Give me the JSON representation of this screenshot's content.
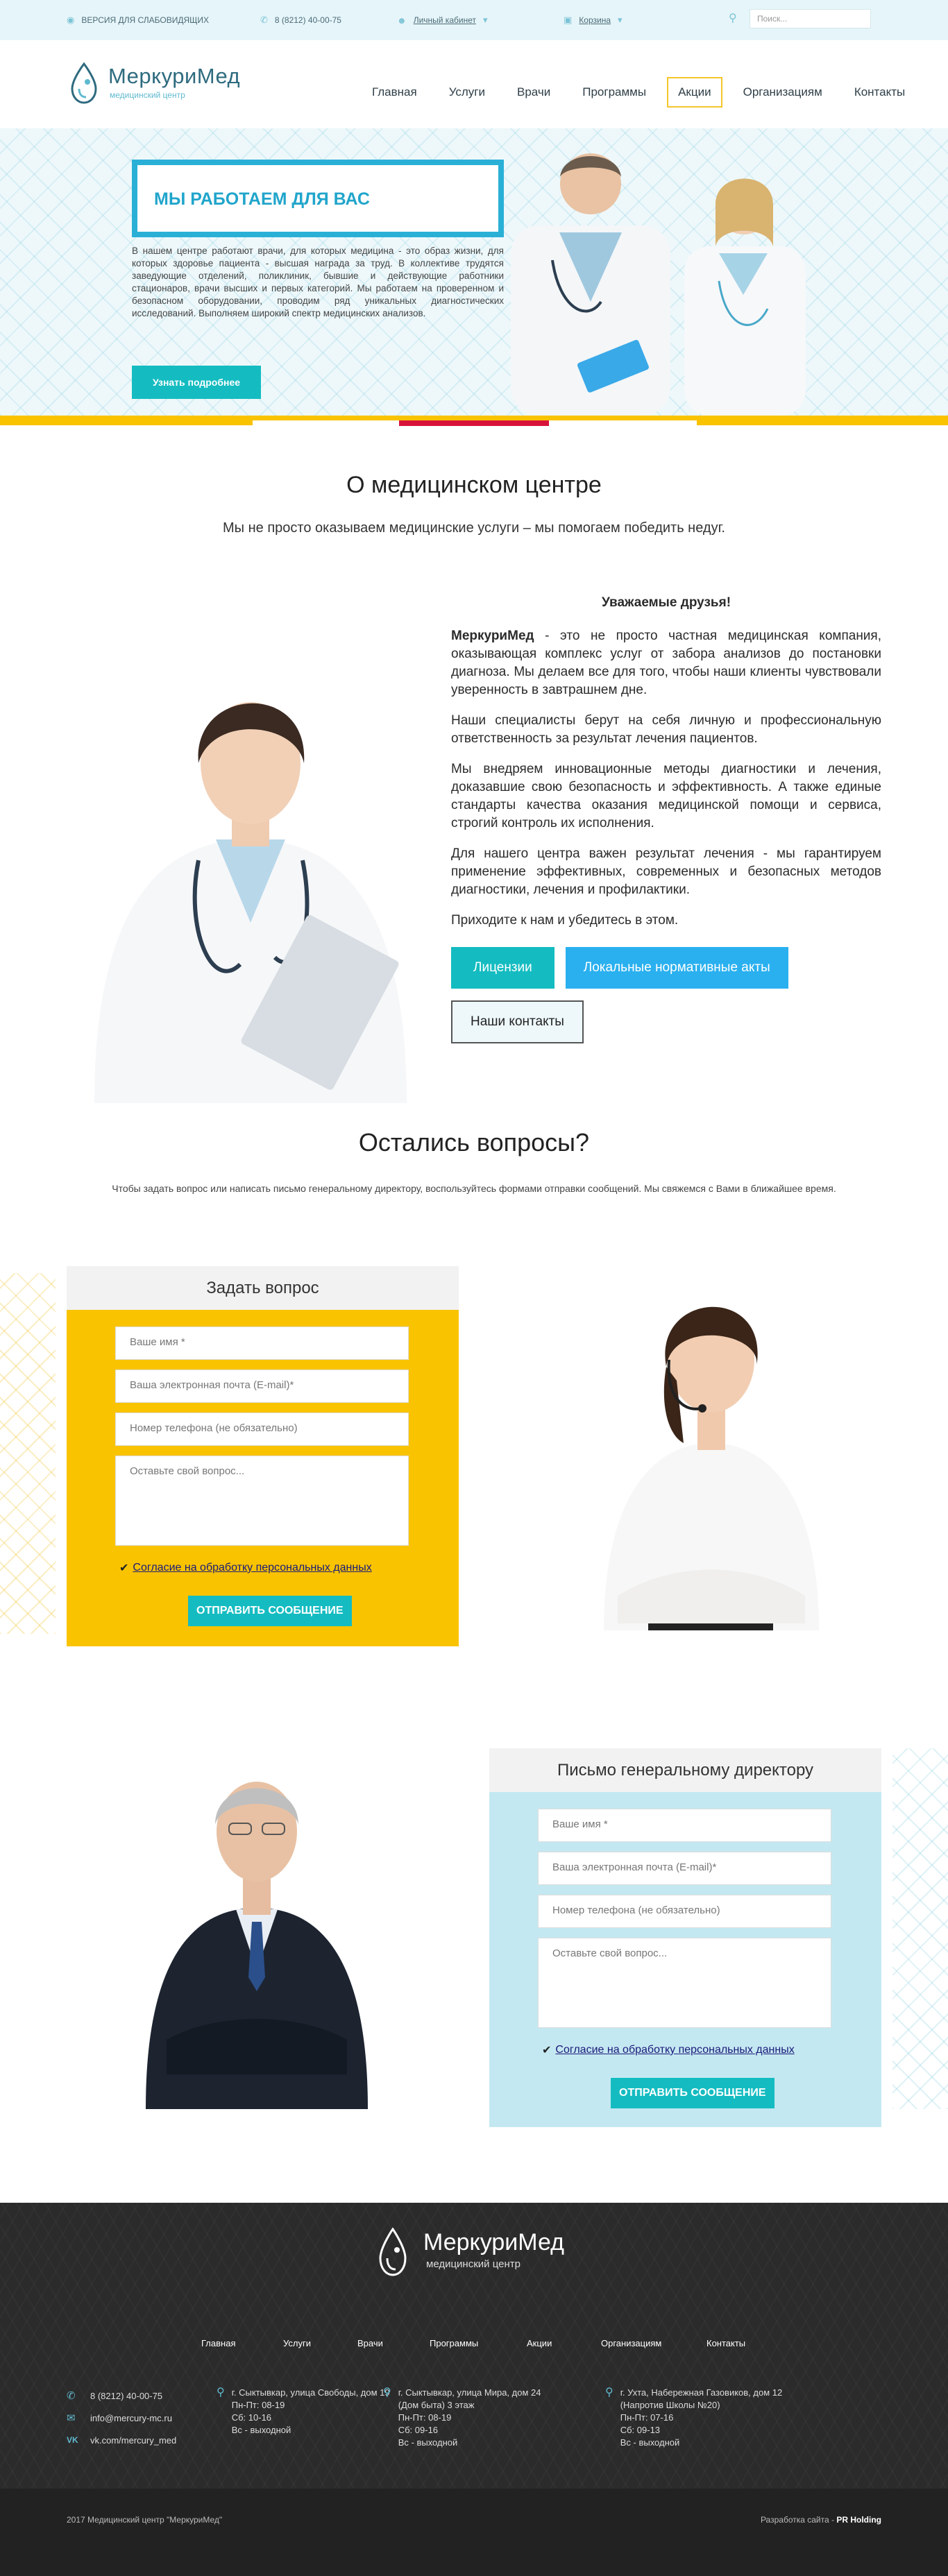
{
  "topbar": {
    "accessibility": "ВЕРСИЯ ДЛЯ СЛАБОВИДЯЩИХ",
    "phone": "8 (8212) 40-00-75",
    "cabinet": "Личный кабинет",
    "cart": "Корзина",
    "search_placeholder": "Поиск..."
  },
  "logo": {
    "name": "МеркуриМед",
    "subtitle": "медицинский центр"
  },
  "nav": {
    "items": [
      "Главная",
      "Услуги",
      "Врачи",
      "Программы",
      "Акции",
      "Организациям",
      "Контакты"
    ],
    "active_index": 4
  },
  "hero": {
    "title": "МЫ РАБОТАЕМ ДЛЯ ВАС",
    "text": "В нашем центре работают врачи, для которых медицина - это образ жизни, для которых здоровье пациента - высшая награда за труд. В коллективе трудятся заведующие отделений, поликлиник, бывшие и действующие работники стационаров, врачи высших и первых категорий. Мы работаем на проверенном и безопасном оборудовании, проводим ряд уникальных диагностических исследований. Выполняем широкий спектр медицинских анализов.",
    "button": "Узнать подробнее"
  },
  "about": {
    "title": "О медицинском центре",
    "subtitle": "Мы не просто оказываем медицинские услуги – мы помогаем победить недуг.",
    "greeting": "Уважаемые друзья!",
    "brand": "МеркуриМед",
    "p1_rest": " - это не просто частная медицинская компания, оказывающая комплекс услуг от забора анализов до постановки диагноза. Мы делаем все для того, чтобы наши клиенты чувствовали уверенность в завтрашнем дне.",
    "p2": "Наши специалисты берут на себя личную и профессиональную ответственность за результат лечения пациентов.",
    "p3": "Мы внедряем инновационные методы диагностики и лечения, доказавшие свою безопасность и эффективность. А также единые стандарты качества оказания медицинской помощи и сервиса, строгий контроль их исполнения.",
    "p4": "Для нашего центра важен результат лечения - мы гарантируем применение эффективных, современных и безопасных методов диагностики, лечения и профилактики.",
    "p5": "Приходите к нам и убедитесь в этом.",
    "btn_licenses": "Лицензии",
    "btn_acts": "Локальные нормативные акты",
    "btn_contacts": "Наши контакты"
  },
  "questions": {
    "title": "Остались вопросы?",
    "subtitle": "Чтобы задать вопрос или написать письмо генеральному директору, воспользуйтесь формами отправки сообщений. Мы свяжемся с Вами в ближайшее время."
  },
  "form_question": {
    "title": "Задать вопрос",
    "name": "Ваше имя *",
    "email": "Ваша электронная почта (E-mail)*",
    "phone": "Номер телефона (не обязательно)",
    "message": "Оставьте свой вопрос...",
    "consent": "Согласие на обработку персональных данных",
    "submit": "ОТПРАВИТЬ СООБЩЕНИЕ"
  },
  "form_director": {
    "title": "Письмо генеральному директору",
    "name": "Ваше имя *",
    "email": "Ваша электронная почта (E-mail)*",
    "phone": "Номер телефона (не обязательно)",
    "message": "Оставьте свой вопрос...",
    "consent": "Согласие на обработку персональных данных",
    "submit": "ОТПРАВИТЬ СООБЩЕНИЕ"
  },
  "footer": {
    "logo_name": "МеркуриМед",
    "logo_sub": "медицинский центр",
    "nav": [
      "Главная",
      "Услуги",
      "Врачи",
      "Программы",
      "Акции",
      "Организациям",
      "Контакты"
    ],
    "phone": "8 (8212) 40-00-75",
    "email": "info@mercury-mc.ru",
    "vk": "vk.com/mercury_med",
    "addr1": "г. Сыктывкар, улица Свободы, дом 19\nПн-Пт: 08-19\nСб: 10-16\nВс - выходной",
    "addr2": "г. Сыктывкар, улица Мира, дом 24 (Дом быта) 3 этаж\nПн-Пт: 08-19\nСб: 09-16\nВс - выходной",
    "addr3": "г. Ухта, Набережная Газовиков, дом 12 (Напротив Школы №20)\nПн-Пт: 07-16\nСб: 09-13\nВс - выходной",
    "copyright": "2017 Медицинский центр \"МеркуриМед\"",
    "dev_label": "Разработка сайта - ",
    "dev_name": "PR Holding"
  },
  "colors": {
    "teal": "#14bcc1",
    "blue": "#2ab0d6",
    "yellow": "#f9c300",
    "light_blue": "#c4e8f1",
    "footer": "#2b2b2b"
  }
}
